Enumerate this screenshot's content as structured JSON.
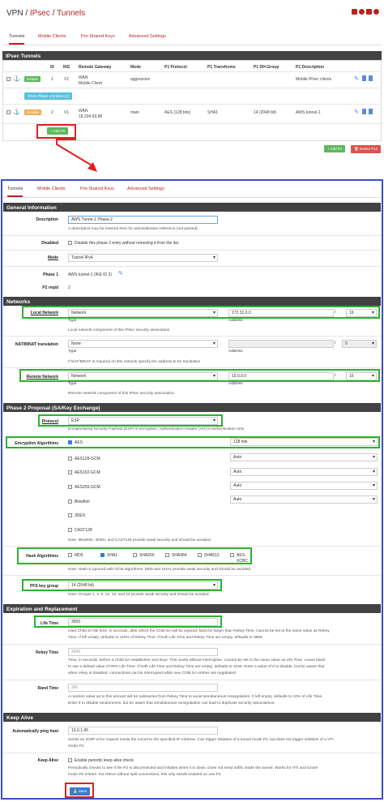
{
  "breadcrumb": {
    "vpn": "VPN",
    "sep1": " / ",
    "ipsec": "IPsec",
    "sep2": " / ",
    "tunnels": "Tunnels"
  },
  "tabs": [
    "Tunnels",
    "Mobile Clients",
    "Pre-Shared Keys",
    "Advanced Settings"
  ],
  "top": {
    "panel_title": "IPsec Tunnels",
    "columns": [
      "ID",
      "IKE",
      "Remote Gateway",
      "Mode",
      "P1 Protocol",
      "P1 Transforms",
      "P1 DH-Group",
      "P1 Description"
    ],
    "row1": {
      "badge": "Enable",
      "id": "1",
      "ike": "V1",
      "gateway1": "WAN",
      "gateway2": "Mobile Client",
      "mode": "aggressive",
      "desc": "Mobile IPsec clients"
    },
    "show_phase2": "Show Phase 2 Entries (1)",
    "row2": {
      "badge": "Disable",
      "id": "2",
      "ike": "V1",
      "gateway1": "WAN",
      "gateway2": "18.204.69.88",
      "mode": "main",
      "protocol": "AES (128 bits)",
      "transforms": "SHA1",
      "dh": "14 (2048 bit)",
      "desc": "AWS tunnel-1"
    },
    "add_p2": "Add P2",
    "add_p1": "Add P1",
    "delete_p1s": "Delete P1s"
  },
  "general": {
    "title": "General Information",
    "description_label": "Description",
    "description_value": "AWS Tunne-1 Phase-2",
    "description_help": "A description may be entered here for administrative reference (not parsed).",
    "disabled_label": "Disabled",
    "disabled_text": "Disable this phase 2 entry without removing it from the list.",
    "mode_label": "Mode",
    "mode_value": "Tunnel IPv4",
    "phase1_label": "Phase 1",
    "phase1_value": "AWS tunnel-1 (IKE ID 2)",
    "p2reqid_label": "P2 reqid",
    "p2reqid_value": "2"
  },
  "networks": {
    "title": "Networks",
    "local_label": "Local Network",
    "local_type": "Network",
    "local_address": "172.31.0.0",
    "local_mask": "16",
    "type_word": "Type",
    "address_word": "Address",
    "local_help": "Local network component of this IPsec security association.",
    "nat_label": "NAT/BINAT translation",
    "nat_type": "None",
    "nat_mask": "0",
    "nat_slash": "/",
    "nat_help": "If NAT/BINAT is required on this network specify the address to be translated",
    "remote_label": "Remote Network",
    "remote_type": "Network",
    "remote_address": "10.0.0.0",
    "remote_mask": "16",
    "remote_help": "Remote network component of this IPsec security association."
  },
  "proposal": {
    "title": "Phase 2 Proposal (SA/Key Exchange)",
    "protocol_label": "Protocol",
    "protocol_value": "ESP",
    "protocol_help": "Encapsulating Security Payload (ESP) is encryption, Authentication Header (AH) is authentication only.",
    "enc_label": "Encryption Algorithms",
    "algos": [
      {
        "name": "AES",
        "key": "128 bits",
        "checked": true
      },
      {
        "name": "AES128-GCM",
        "key": "Auto",
        "checked": false
      },
      {
        "name": "AES192-GCM",
        "key": "Auto",
        "checked": false
      },
      {
        "name": "AES256-GCM",
        "key": "Auto",
        "checked": false
      },
      {
        "name": "Blowfish",
        "key": "Auto",
        "checked": false
      },
      {
        "name": "3DES",
        "key": "",
        "checked": false
      },
      {
        "name": "CAST128",
        "key": "",
        "checked": false
      }
    ],
    "enc_help": "Note: Blowfish, 3DES, and CAST128 provide weak security and should be avoided.",
    "hash_label": "Hash Algorithms",
    "hashes": [
      {
        "name": "MD5",
        "checked": false
      },
      {
        "name": "SHA1",
        "checked": true
      },
      {
        "name": "SHA256",
        "checked": false
      },
      {
        "name": "SHA384",
        "checked": false
      },
      {
        "name": "SHA512",
        "checked": false
      },
      {
        "name": "AES-XCBC",
        "checked": false
      }
    ],
    "hash_help": "Note: Hash is ignored with GCM algorithms. MD5 and SHA1 provide weak security and should be avoided.",
    "pfs_label": "PFS key group",
    "pfs_value": "14 (2048 bit)",
    "pfs_help": "Note: Groups 1, 2, 5, 22, 23, and 24 provide weak security and should be avoided."
  },
  "expiration": {
    "title": "Expiration and Replacement",
    "lifetime_label": "Life Time",
    "lifetime_value": "3600",
    "lifetime_help1": "Hard Child SA life time, in seconds, after which the Child SA will be expired. Must be larger than Rekey Time. Cannot be set to the same value as Rekey",
    "lifetime_help2": "Time. If left empty, defaults to 110% of Rekey Time. If both Life Time and Rekey Time are empty, defaults to 3960.",
    "rekey_label": "Rekey Time",
    "rekey_placeholder": "3240",
    "rekey_help1": "Time, in seconds, before a Child SA establishes new keys. This works without interruption. Cannot be set to the same value as Life Time. Leave blank",
    "rekey_help2": "to use a default value of 90% Life Time. If both Life Time and Rekey Time are empty, defaults to 3240. Enter a value of 0 to disable, but be aware that",
    "rekey_help3": "when rekey is disabled, connections can be interrupted while new Child SA entries are negotiated.",
    "rand_label": "Rand Time",
    "rand_placeholder": "360",
    "rand_help1": "A random value up to this amount will be subtracted from Rekey Time to avoid simultaneous renegotiation. If left empty, defaults to 10% of Life Time.",
    "rand_help2": "Enter 0 to disable randomness, but be aware that simultaneous renegotiation can lead to duplicate security associations."
  },
  "keepalive": {
    "title": "Keep Alive",
    "ping_label": "Automatically ping host",
    "ping_value": "10.0.1.45",
    "ping_help1": "Sends an ICMP echo request inside the tunnel to the specified IP Address. Can trigger initiation of a tunnel mode P2, but does not trigger initiation of a VTI",
    "ping_help2": "mode P2.",
    "ka_label": "Keep Alive",
    "ka_text": "Enable periodic keep alive check",
    "ka_help1": "Periodically checks to see if the P2 is disconnected and initiates when it is down. Does not send traffic inside the tunnel. Works for VTI and tunnel",
    "ka_help2": "mode P2 entries. For IKEv2 without split connections, this only needs enabled on one P2."
  },
  "save_label": "Save",
  "colors": {
    "accent": "#b22222",
    "panel": "#424242",
    "green": "#2db12d",
    "red": "#e02020",
    "blue": "#3b4fc4"
  }
}
